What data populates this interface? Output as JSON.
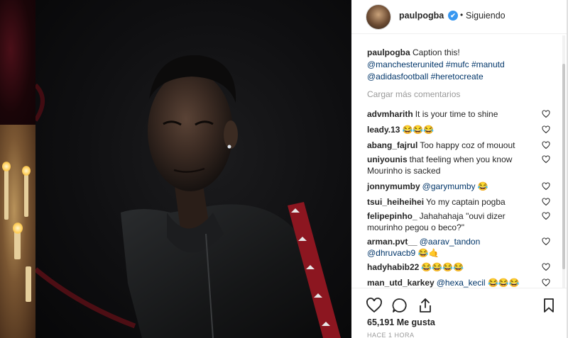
{
  "post": {
    "username": "paulpogba",
    "verified_mark": "✔",
    "separator": "•",
    "follow_status": "Siguiendo",
    "caption": {
      "user": "paulpogba",
      "text": "Caption this!",
      "tags": [
        "@manchesterunited",
        "#mufc",
        "#manutd",
        "@adidasfootball",
        "#heretocreate"
      ]
    },
    "load_more": "Cargar más comentarios",
    "comments": [
      {
        "user": "advmharith",
        "text": "It is your time to shine"
      },
      {
        "user": "leady.13",
        "text": "😂😂😂"
      },
      {
        "user": "abang_fajrul",
        "text": "Too happy coz of mouout"
      },
      {
        "user": "uniyounis",
        "text": "that feeling when you know Mourinho is sacked"
      },
      {
        "user": "jonnymumby",
        "mention": "@garymumby",
        "text": "😂"
      },
      {
        "user": "tsui_heiheihei",
        "text": "Yo my captain pogba"
      },
      {
        "user": "felipepinho_",
        "text": "Jahahahaja \"ouvi dizer mourinho pegou o beco?\""
      },
      {
        "user": "arman.pvt__",
        "mention": "@aarav_tandon",
        "mention2": "@dhruvacb9",
        "text": "😂🤙"
      },
      {
        "user": "hadyhabib22",
        "text": "😂😂😂😂"
      },
      {
        "user": "man_utd_karkey",
        "mention": "@hexa_kecil",
        "text": "😂😂😂",
        "text2": "😂😂"
      }
    ],
    "likes": "65,191 Me gusta",
    "date": "HACE 1 HORA"
  },
  "icons": {
    "like": "heart-icon",
    "comment": "comment-icon",
    "share": "share-icon",
    "save": "bookmark-icon"
  },
  "colors": {
    "link": "#003569",
    "verified": "#3897f0",
    "muted": "#999999"
  }
}
